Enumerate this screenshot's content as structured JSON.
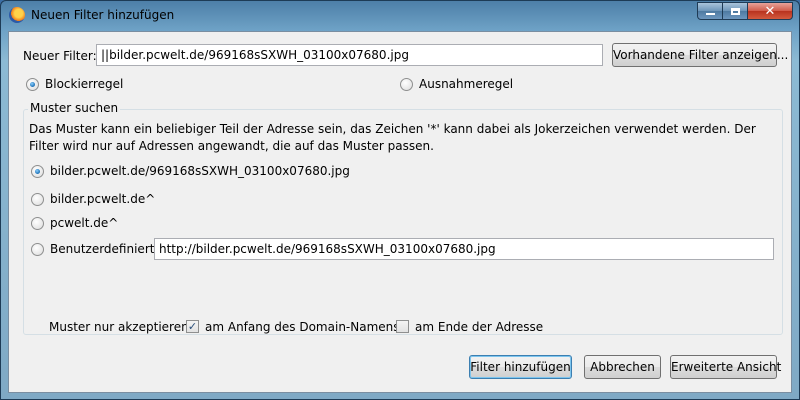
{
  "window": {
    "title": "Neuen Filter hinzufügen",
    "accent_color": "#6fa3c7",
    "minimize_icon": "minimize-icon",
    "maximize_icon": "maximize-icon",
    "close_icon": "close-icon",
    "close_glyph": "✕"
  },
  "filter": {
    "label": "Neuer Filter:",
    "value": "||bilder.pcwelt.de/969168sSXWH_03100x07680.jpg",
    "show_existing_button": "Vorhandene Filter anzeigen..."
  },
  "rule_type": {
    "block_label": "Blockierregel",
    "exception_label": "Ausnahmeregel",
    "selected": "block"
  },
  "pattern": {
    "group_title": "Muster suchen",
    "description": "Das Muster kann ein beliebiger Teil der Adresse sein, das Zeichen '*' kann dabei als Jokerzeichen verwendet werden. Der Filter wird nur auf Adressen angewandt, die auf das Muster passen.",
    "options": [
      {
        "label": "bilder.pcwelt.de/969168sSXWH_03100x07680.jpg",
        "checked": true
      },
      {
        "label": "bilder.pcwelt.de^",
        "checked": false
      },
      {
        "label": "pcwelt.de^",
        "checked": false
      }
    ],
    "custom_label": "Benutzerdefiniert:",
    "custom_value": "http://bilder.pcwelt.de/969168sSXWH_03100x07680.jpg"
  },
  "accept": {
    "label": "Muster nur akzeptieren:",
    "domain_start_label": "am Anfang des Domain-Namens",
    "domain_start_checked": true,
    "address_end_label": "am Ende der Adresse",
    "address_end_checked": false,
    "check_glyph": "✓"
  },
  "buttons": {
    "add": "Filter hinzufügen",
    "cancel": "Abbrechen",
    "advanced": "Erweiterte Ansicht"
  }
}
